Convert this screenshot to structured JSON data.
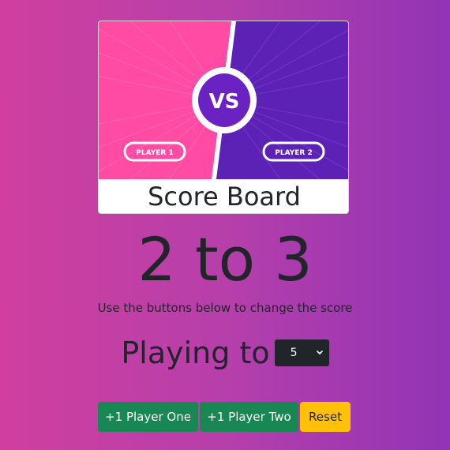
{
  "banner": {
    "vs_text": "VS",
    "player1_tag": "PLAYER 1",
    "player2_tag": "PLAYER 2",
    "colors": {
      "left": "#ff4ba3",
      "right": "#5b22b5",
      "badge": "#6b22c2"
    }
  },
  "card": {
    "title": "Score Board"
  },
  "score": {
    "player_one": "2",
    "separator": "to",
    "player_two": "3"
  },
  "hint": "Use the buttons below to change the score",
  "playing_to": {
    "label": "Playing to",
    "selected": "5"
  },
  "buttons": {
    "player_one": "+1 Player One",
    "player_two": "+1 Player Two",
    "reset": "Reset"
  }
}
